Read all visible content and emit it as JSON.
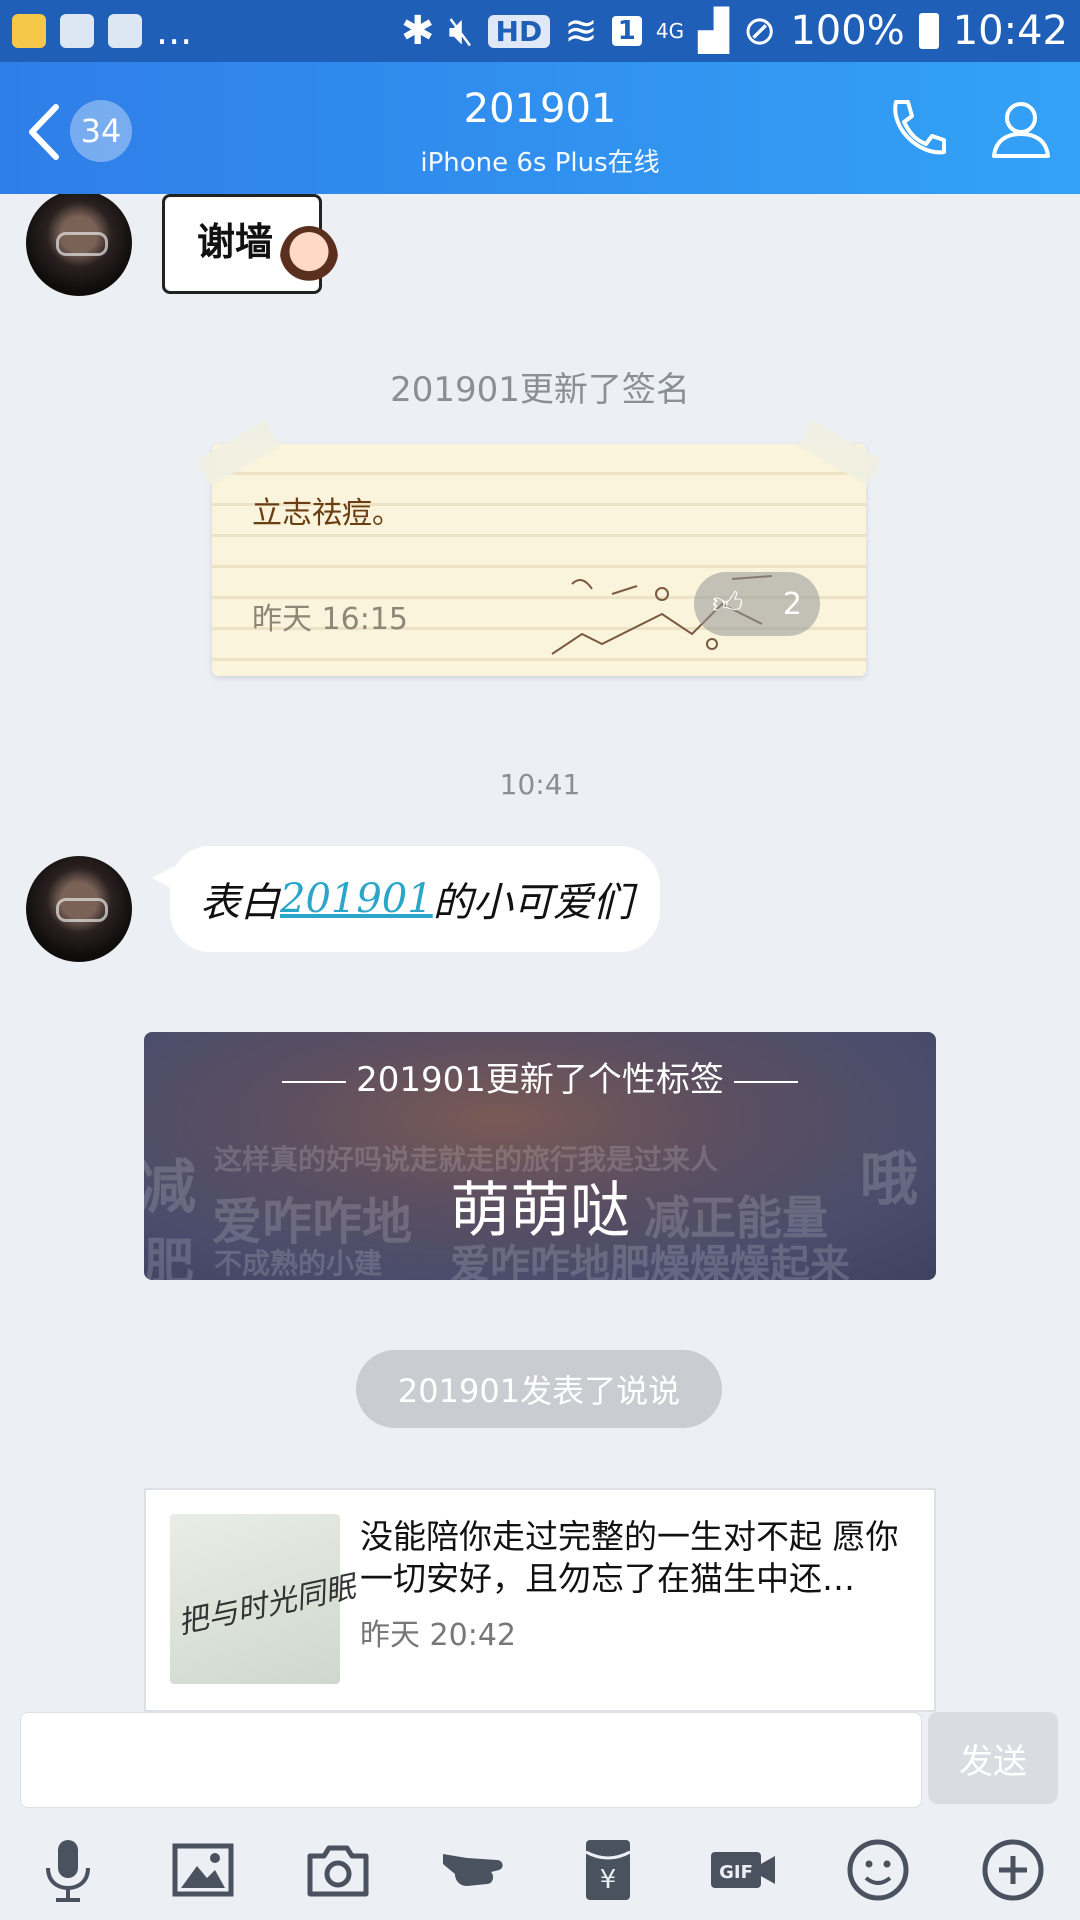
{
  "status_bar": {
    "more": "...",
    "hd": "HD",
    "sim": "1",
    "network": "4G",
    "battery": "100%",
    "time": "10:42"
  },
  "header": {
    "unread_count": "34",
    "title": "201901",
    "subtitle": "iPhone 6s Plus在线"
  },
  "chat": {
    "sticker_text": "谢墙",
    "signature_update": "201901更新了签名",
    "signature_card": {
      "text": "立志祛痘。",
      "time": "昨天 16:15",
      "likes": "2"
    },
    "timestamp": "10:41",
    "message": {
      "before": "表白",
      "link": "201901",
      "after": "的小可爱们"
    },
    "tag_card": {
      "title": "201901更新了个性标签",
      "main": "萌萌哒",
      "background_words": [
        "减",
        "这样真的好吗说走就走的旅行我是过来人",
        "哦",
        "爱咋咋地",
        "减正能量",
        "肥",
        "不成熟的小建",
        "爱咋咋地肥燥燥燥起来"
      ]
    },
    "post_notice": "201901发表了说说",
    "post": {
      "image_text": "把与时光同眠",
      "text": "没能陪你走过完整的一生对不起 愿你一切安好，且勿忘了在猫生中还…",
      "time": "昨天 20:42"
    }
  },
  "input": {
    "value": "",
    "send_label": "发送"
  },
  "toolbar": [
    "microphone-icon",
    "image-icon",
    "camera-icon",
    "poke-icon",
    "red-packet-icon",
    "gif-icon",
    "emoji-icon",
    "plus-icon"
  ],
  "colors": {
    "header_start": "#2f7ee8",
    "header_end": "#33a2f6",
    "status_bar": "#1f5fb7",
    "link": "#2aa6c9",
    "background": "#eceff4"
  }
}
